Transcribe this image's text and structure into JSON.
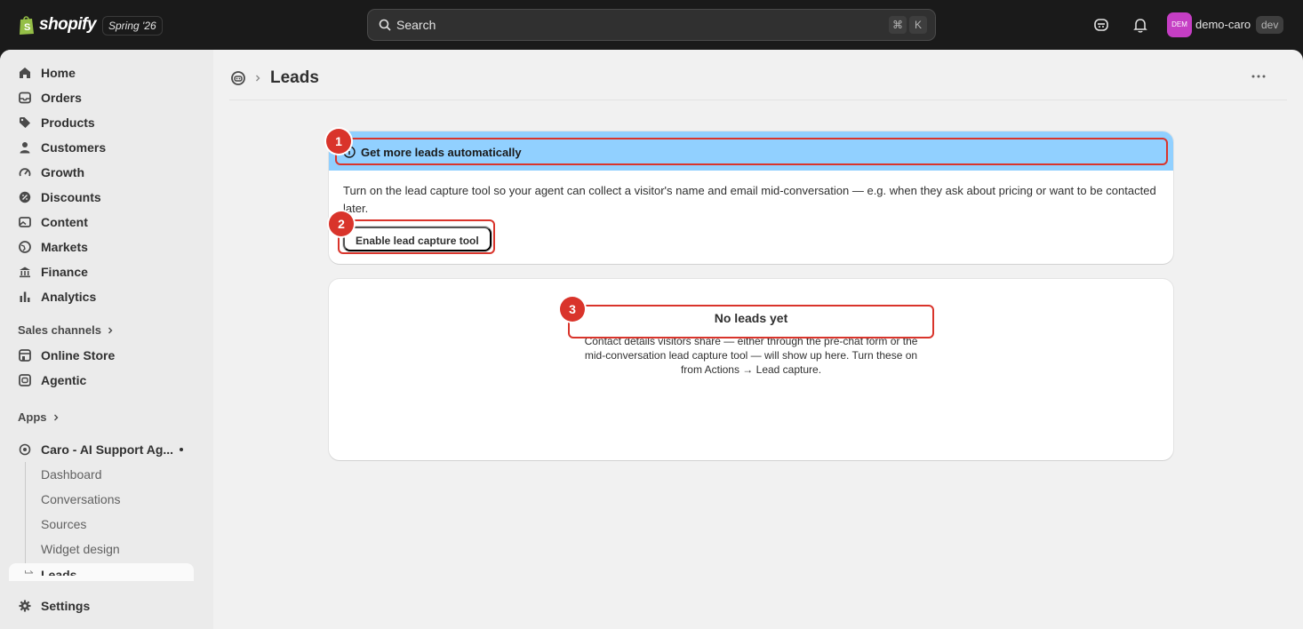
{
  "topbar": {
    "brand": "shopify",
    "edition": "Spring '26",
    "search_placeholder": "Search",
    "shortcut_cmd": "⌘",
    "shortcut_key": "K",
    "avatar_initials": "DEM",
    "store_name": "demo-caro",
    "env_badge": "dev"
  },
  "sidebar": {
    "main_items": [
      {
        "label": "Home",
        "icon": "home-icon"
      },
      {
        "label": "Orders",
        "icon": "inbox-icon"
      },
      {
        "label": "Products",
        "icon": "tag-icon"
      },
      {
        "label": "Customers",
        "icon": "person-icon"
      },
      {
        "label": "Growth",
        "icon": "gauge-icon"
      },
      {
        "label": "Discounts",
        "icon": "discount-icon"
      },
      {
        "label": "Content",
        "icon": "image-icon"
      },
      {
        "label": "Markets",
        "icon": "globe-icon"
      },
      {
        "label": "Finance",
        "icon": "bank-icon"
      },
      {
        "label": "Analytics",
        "icon": "bar-chart-icon"
      }
    ],
    "sales_channels_label": "Sales channels",
    "channels": [
      {
        "label": "Online Store",
        "icon": "store-icon"
      },
      {
        "label": "Agentic",
        "icon": "robot-icon"
      }
    ],
    "apps_label": "Apps",
    "app": {
      "label": "Caro - AI Support Ag...",
      "icon": "app-icon"
    },
    "app_subitems": [
      "Dashboard",
      "Conversations",
      "Sources",
      "Widget design",
      "Leads"
    ],
    "settings_label": "Settings"
  },
  "page": {
    "title": "Leads"
  },
  "banner": {
    "title": "Get more leads automatically",
    "body": "Turn on the lead capture tool so your agent can collect a visitor's name and email mid-conversation — e.g. when they ask about pricing or want to be contacted later.",
    "button": "Enable lead capture tool"
  },
  "empty_state": {
    "title": "No leads yet",
    "text": "Contact details visitors share — either through the pre-chat form or the mid-conversation lead capture tool — will show up here. Turn these on from Actions → Lead capture."
  },
  "annotations": [
    "1",
    "2",
    "3"
  ],
  "colors": {
    "banner_bg": "#91d0ff",
    "annotation": "#d9342b",
    "avatar": "#c53ec4"
  }
}
